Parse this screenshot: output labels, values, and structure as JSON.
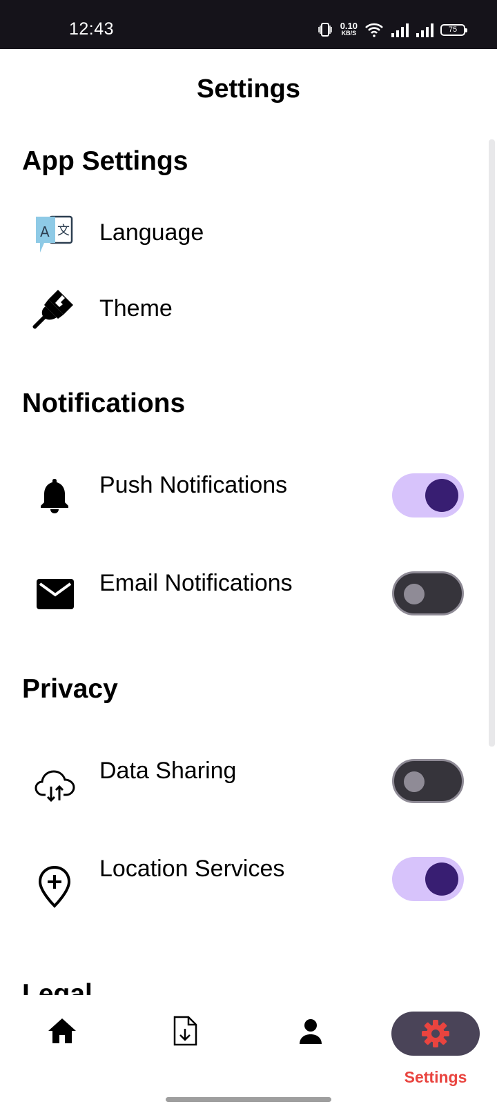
{
  "status_bar": {
    "time": "12:43",
    "net_speed_value": "0.10",
    "net_speed_unit": "KB/S",
    "battery": "75"
  },
  "header": {
    "title": "Settings"
  },
  "sections": {
    "app_settings": {
      "title": "App Settings",
      "language_label": "Language",
      "theme_label": "Theme"
    },
    "notifications": {
      "title": "Notifications",
      "push_label": "Push Notifications",
      "push_enabled": true,
      "email_label": "Email Notifications",
      "email_enabled": false
    },
    "privacy": {
      "title": "Privacy",
      "data_sharing_label": "Data Sharing",
      "data_sharing_enabled": false,
      "location_label": "Location Services",
      "location_enabled": true
    },
    "legal": {
      "title": "Legal"
    }
  },
  "bottom_nav": {
    "items": [
      {
        "icon": "home-icon"
      },
      {
        "icon": "download-file-icon"
      },
      {
        "icon": "person-icon"
      },
      {
        "icon": "gear-icon",
        "label": "Settings",
        "active": true
      }
    ]
  },
  "colors": {
    "toggle_on_track": "#d7c3fb",
    "toggle_on_knob": "#381e72",
    "toggle_off_track": "#36343b",
    "toggle_off_outline": "#8f8b96",
    "active_nav_accent": "#e9443f",
    "active_nav_pill": "#4a4458"
  }
}
